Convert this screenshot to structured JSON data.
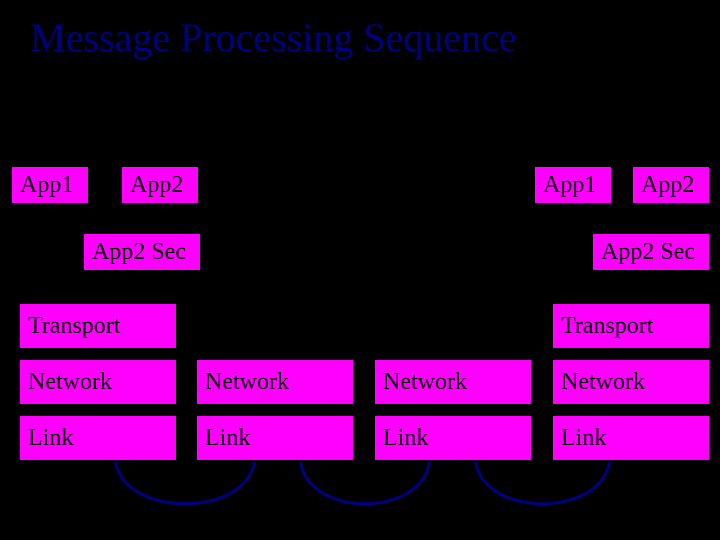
{
  "title": "Message Processing Sequence",
  "left": {
    "app1": "App1",
    "app2": "App2",
    "app2sec": "App2 Sec",
    "transport": "Transport",
    "network": "Network",
    "link": "Link"
  },
  "mid1": {
    "network": "Network",
    "link": "Link"
  },
  "mid2": {
    "network": "Network",
    "link": "Link"
  },
  "right": {
    "app1": "App1",
    "app2": "App2",
    "app2sec": "App2 Sec",
    "transport": "Transport",
    "network": "Network",
    "link": "Link"
  }
}
